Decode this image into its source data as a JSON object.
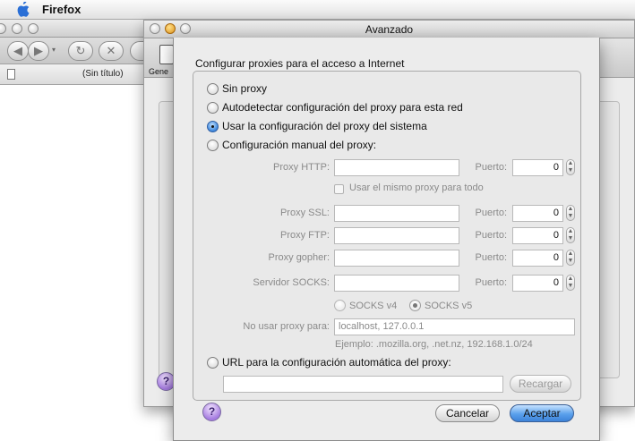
{
  "menubar": {
    "app_name": "Firefox",
    "icon": "apple-logo-icon"
  },
  "firefox_window": {
    "tab_title": "(Sin título)"
  },
  "prefs_window": {
    "title": "Avanzado",
    "panel_label": "Gene"
  },
  "sheet": {
    "heading": "Configurar proxies para el acceso a Internet",
    "options": {
      "no_proxy": "Sin proxy",
      "autodetect": "Autodetectar configuración del proxy para esta red",
      "system": "Usar la configuración del proxy del sistema",
      "manual": "Configuración manual del proxy:",
      "auto_url": "URL para la configuración automática del proxy:"
    },
    "selected_option": "system",
    "port_label": "Puerto:",
    "http": {
      "label": "Proxy HTTP:",
      "value": "",
      "port": "0"
    },
    "same_proxy_label": "Usar el mismo proxy para todo",
    "ssl": {
      "label": "Proxy SSL:",
      "value": "",
      "port": "0"
    },
    "ftp": {
      "label": "Proxy FTP:",
      "value": "",
      "port": "0"
    },
    "gopher": {
      "label": "Proxy gopher:",
      "value": "",
      "port": "0"
    },
    "socks": {
      "label": "Servidor SOCKS:",
      "value": "",
      "port": "0"
    },
    "socks_v4": "SOCKS v4",
    "socks_v5": "SOCKS v5",
    "socks_selected": "v5",
    "no_proxy_for": {
      "label": "No usar proxy para:",
      "value": "localhost, 127.0.0.1",
      "example": "Ejemplo: .mozilla.org, .net.nz, 192.168.1.0/24"
    },
    "auto_config_url": "",
    "reload_button": "Recargar",
    "cancel_button": "Cancelar",
    "accept_button": "Aceptar",
    "help_glyph": "?"
  }
}
